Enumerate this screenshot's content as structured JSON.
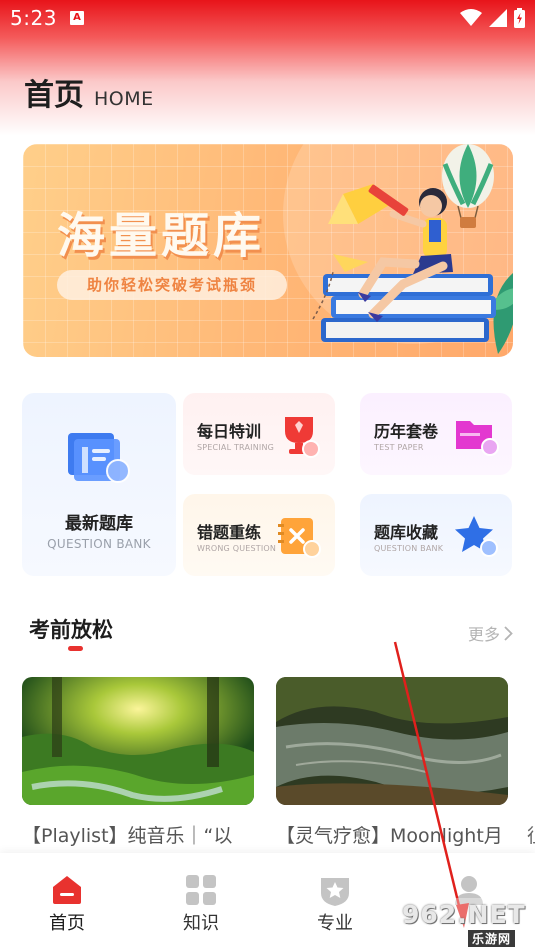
{
  "status_bar": {
    "time": "5:23",
    "notification_badge": "A"
  },
  "header": {
    "title": "首页",
    "subtitle": "HOME"
  },
  "banner": {
    "title": "海量题库",
    "tagline": "助你轻松突破考试瓶颈"
  },
  "features": {
    "latest_bank": {
      "title": "最新题库",
      "subtitle": "QUESTION BANK",
      "icon": "question-bank-icon"
    },
    "daily_training": {
      "title": "每日特训",
      "subtitle": "SPECIAL TRAINING",
      "icon": "trophy-icon"
    },
    "past_papers": {
      "title": "历年套卷",
      "subtitle": "TEST PAPER",
      "icon": "folder-icon"
    },
    "wrong_questions": {
      "title": "错题重练",
      "subtitle": "WRONG QUESTION",
      "icon": "notebook-x-icon"
    },
    "favorites": {
      "title": "题库收藏",
      "subtitle": "QUESTION BANK",
      "icon": "star-icon"
    }
  },
  "relax_section": {
    "title": "考前放松",
    "more_label": "更多",
    "videos": [
      {
        "title": "【Playlist】纯音乐｜“以"
      },
      {
        "title": "【灵气疗愈】Moonlight月"
      }
    ],
    "edge_char": "徂"
  },
  "tabbar": {
    "items": [
      {
        "label": "首页",
        "icon": "home-icon",
        "active": true
      },
      {
        "label": "知识",
        "icon": "grid-icon",
        "active": false
      },
      {
        "label": "专业",
        "icon": "shield-star-icon",
        "active": false
      },
      {
        "label": "",
        "icon": "profile-icon",
        "active": false
      }
    ]
  },
  "watermark": {
    "main": "962.NET",
    "sub": "乐游网"
  },
  "colors": {
    "accent": "#e8141a",
    "banner": "#ffb877",
    "tab_active": "#e8322f",
    "tab_inactive": "#c4c4c4"
  }
}
